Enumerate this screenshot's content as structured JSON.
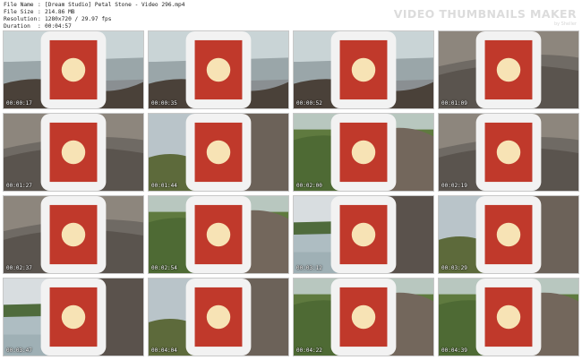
{
  "file_info": {
    "name_key": "File Name",
    "name_value": "[Dream Studio] Petal Stone - Video 296.mp4",
    "size_key": "File Size",
    "size_value": "214.86 MB",
    "resolution_key": "Resolution",
    "resolution_value": "1280x720 / 29.97 fps",
    "duration_key": "Duration",
    "duration_value": "00:04:57",
    "separator": ":"
  },
  "brand": {
    "title": "VIDEO THUMBNAILS MAKER",
    "subtitle": "by Sheller"
  },
  "thumbnails": [
    {
      "timestamp": "00:00:17",
      "scene": "water-rock"
    },
    {
      "timestamp": "00:00:35",
      "scene": "water-rock"
    },
    {
      "timestamp": "00:00:52",
      "scene": "water-rock"
    },
    {
      "timestamp": "00:01:09",
      "scene": "rock-close"
    },
    {
      "timestamp": "00:01:27",
      "scene": "rock-close"
    },
    {
      "timestamp": "00:01:44",
      "scene": "rock-sky"
    },
    {
      "timestamp": "00:02:00",
      "scene": "green-rock"
    },
    {
      "timestamp": "00:02:19",
      "scene": "rock-close"
    },
    {
      "timestamp": "00:02:37",
      "scene": "rock-close"
    },
    {
      "timestamp": "00:02:54",
      "scene": "green-rock"
    },
    {
      "timestamp": "00:03:12",
      "scene": "river-rock"
    },
    {
      "timestamp": "00:03:29",
      "scene": "rock-sky"
    },
    {
      "timestamp": "00:03:47",
      "scene": "river-rock"
    },
    {
      "timestamp": "00:04:04",
      "scene": "rock-sky"
    },
    {
      "timestamp": "00:04:22",
      "scene": "green-rock"
    },
    {
      "timestamp": "00:04:39",
      "scene": "green-rock"
    }
  ]
}
